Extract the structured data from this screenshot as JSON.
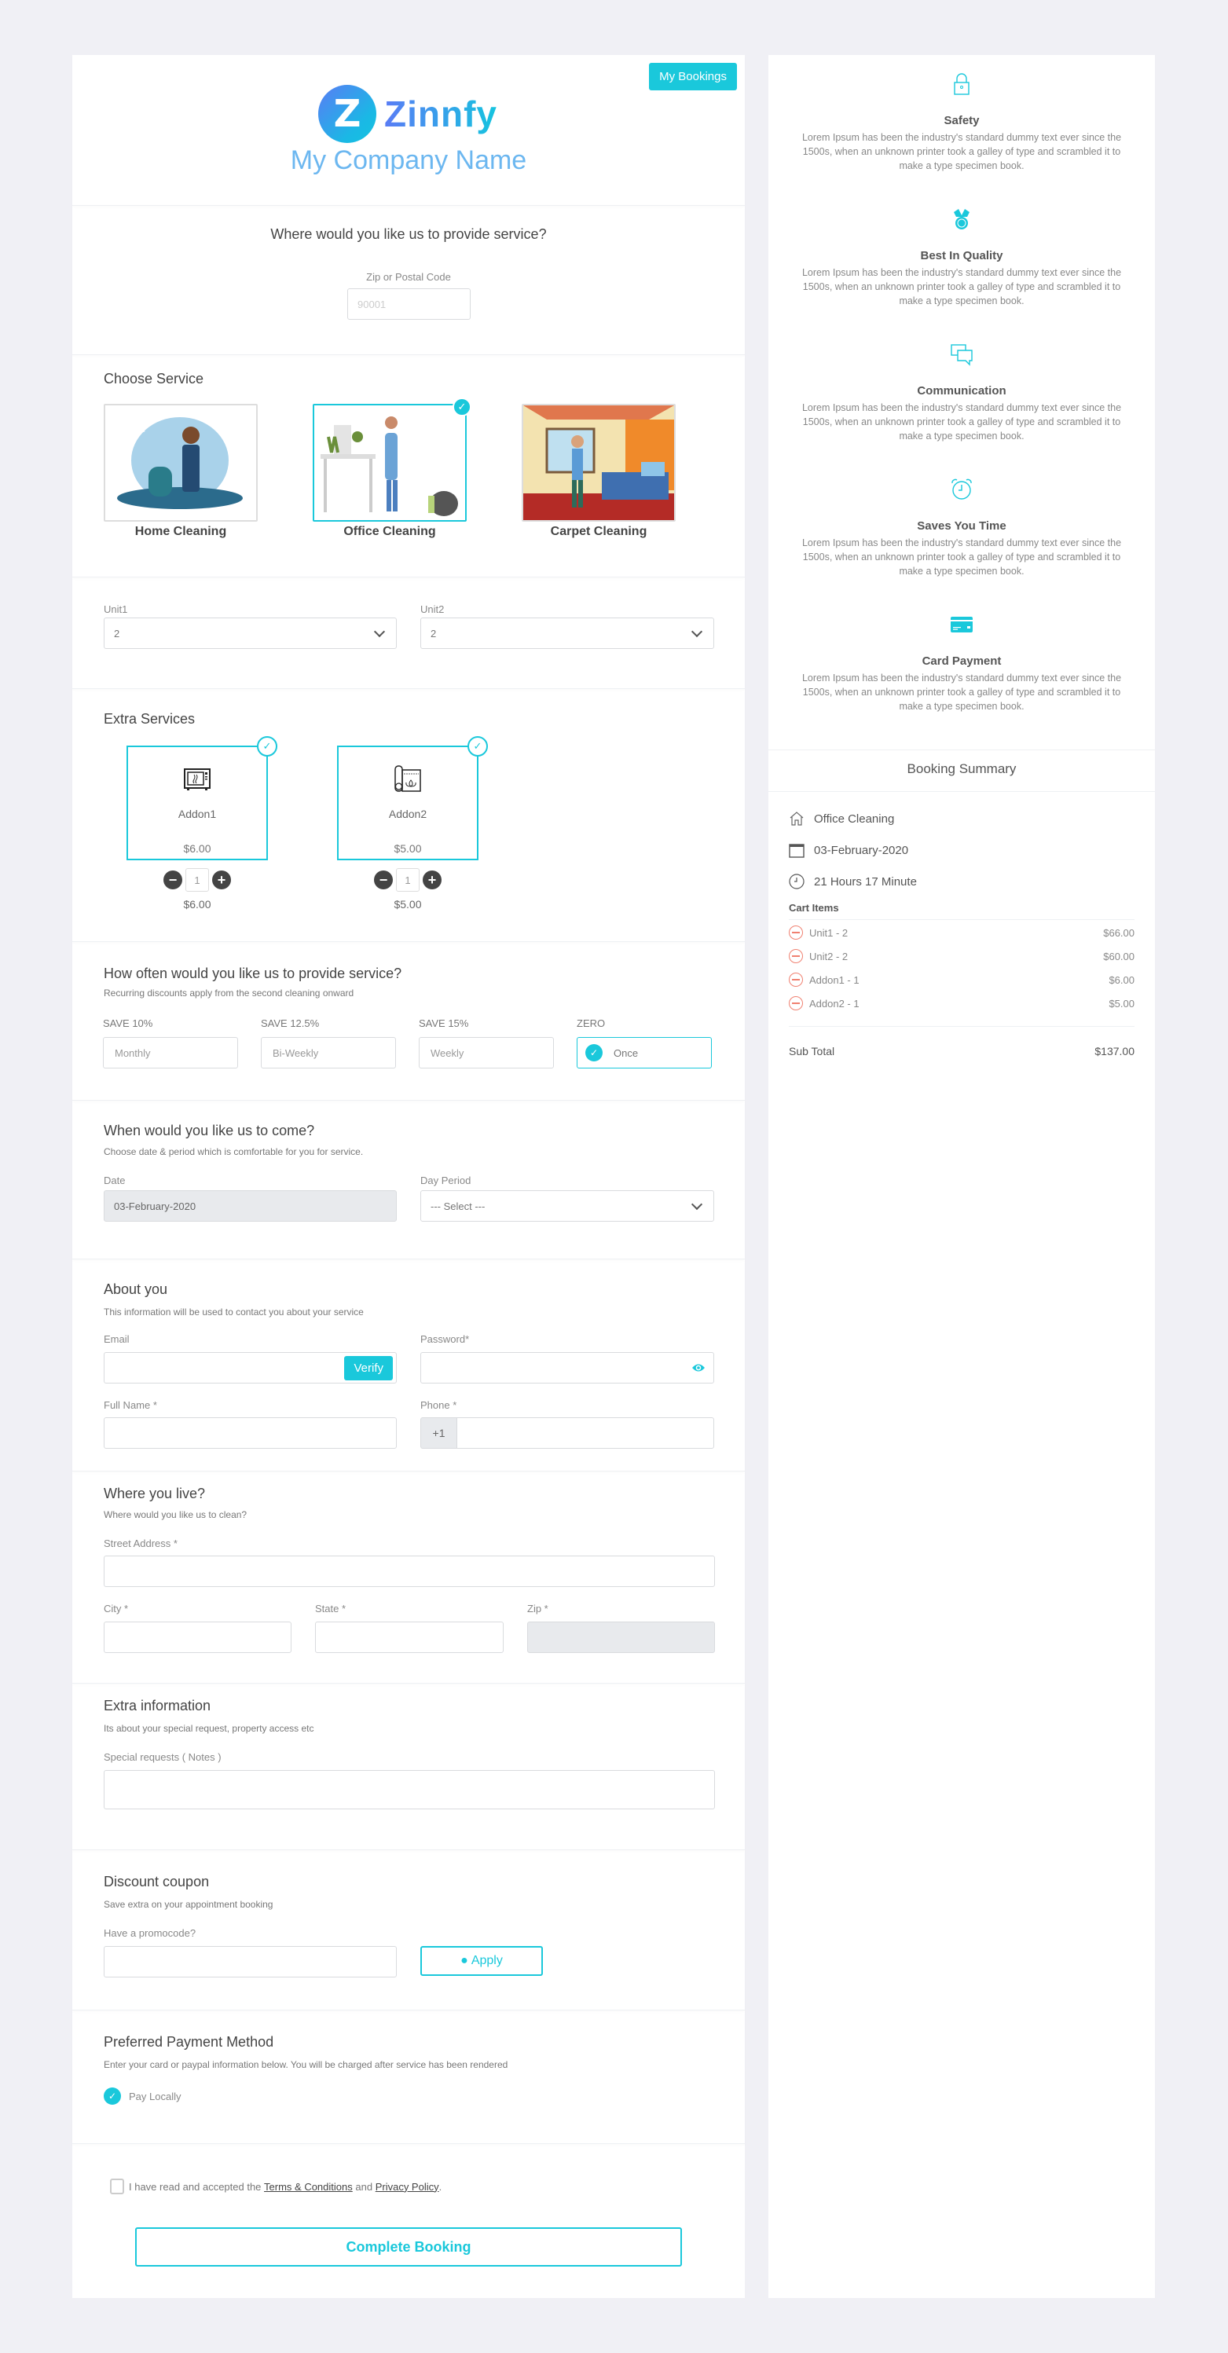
{
  "header": {
    "my_bookings": "My Bookings",
    "logo_letter": "Z",
    "logo_text": "Zinnfy",
    "company_name": "My Company Name"
  },
  "location": {
    "title": "Where would you like us to provide service?",
    "zip_label": "Zip or Postal Code",
    "zip_placeholder": "90001"
  },
  "choose_service": {
    "title": "Choose Service",
    "items": [
      {
        "name": "Home Cleaning",
        "selected": false
      },
      {
        "name": "Office Cleaning",
        "selected": true
      },
      {
        "name": "Carpet Cleaning",
        "selected": false
      }
    ]
  },
  "units": {
    "unit1_label": "Unit1",
    "unit1_value": "2",
    "unit2_label": "Unit2",
    "unit2_value": "2"
  },
  "extra_services": {
    "title": "Extra Services",
    "items": [
      {
        "name": "Addon1",
        "price": "$6.00",
        "qty": "1",
        "total": "$6.00",
        "icon": "microwave-icon",
        "selected": true
      },
      {
        "name": "Addon2",
        "price": "$5.00",
        "qty": "1",
        "total": "$5.00",
        "icon": "yoga-mat-icon",
        "selected": true
      }
    ]
  },
  "frequency": {
    "title": "How often would you like us to provide service?",
    "subtitle": "Recurring discounts apply from the second cleaning onward",
    "options": [
      {
        "save": "SAVE 10%",
        "label": "Monthly",
        "selected": false
      },
      {
        "save": "SAVE 12.5%",
        "label": "Bi-Weekly",
        "selected": false
      },
      {
        "save": "SAVE 15%",
        "label": "Weekly",
        "selected": false
      },
      {
        "save": "ZERO",
        "label": "Once",
        "selected": true
      }
    ]
  },
  "schedule": {
    "title": "When would you like us to come?",
    "subtitle": "Choose date & period which is comfortable for you for service.",
    "date_label": "Date",
    "date_value": "03-February-2020",
    "period_label": "Day Period",
    "period_value": "--- Select ---"
  },
  "about": {
    "title": "About you",
    "subtitle": "This information will be used to contact you about your service",
    "email_label": "Email",
    "verify": "Verify",
    "password_label": "Password*",
    "fullname_label": "Full Name *",
    "phone_label": "Phone *",
    "phone_prefix": "+1"
  },
  "address": {
    "title": "Where you live?",
    "subtitle": "Where would you like us to clean?",
    "street_label": "Street Address *",
    "city_label": "City *",
    "state_label": "State *",
    "zip_label": "Zip *"
  },
  "extra_info": {
    "title": "Extra information",
    "subtitle": "Its about your special request, property access etc",
    "notes_label": "Special requests ( Notes )"
  },
  "coupon": {
    "title": "Discount coupon",
    "subtitle": "Save extra on your appointment booking",
    "promo_label": "Have a promocode?",
    "apply": "Apply"
  },
  "payment": {
    "title": "Preferred Payment Method",
    "subtitle": "Enter your card or paypal information below. You will be charged after service has been rendered",
    "option": "Pay Locally",
    "selected": true
  },
  "footer": {
    "terms_prefix": "I have read and accepted the ",
    "terms_link": "Terms & Conditions",
    "and": " and ",
    "privacy_link": "Privacy Policy",
    "period": ".",
    "complete": "Complete Booking"
  },
  "features": [
    {
      "title": "Safety",
      "icon": "lock-icon",
      "desc": "Lorem Ipsum has been the industry's standard dummy text ever since the 1500s, when an unknown printer took a galley of type and scrambled it to make a type specimen book."
    },
    {
      "title": "Best In Quality",
      "icon": "medal-icon",
      "desc": "Lorem Ipsum has been the industry's standard dummy text ever since the 1500s, when an unknown printer took a galley of type and scrambled it to make a type specimen book."
    },
    {
      "title": "Communication",
      "icon": "chat-icon",
      "desc": "Lorem Ipsum has been the industry's standard dummy text ever since the 1500s, when an unknown printer took a galley of type and scrambled it to make a type specimen book."
    },
    {
      "title": "Saves You Time",
      "icon": "alarm-clock-icon",
      "desc": "Lorem Ipsum has been the industry's standard dummy text ever since the 1500s, when an unknown printer took a galley of type and scrambled it to make a type specimen book."
    },
    {
      "title": "Card Payment",
      "icon": "credit-card-icon",
      "desc": "Lorem Ipsum has been the industry's standard dummy text ever since the 1500s, when an unknown printer took a galley of type and scrambled it to make a type specimen book."
    }
  ],
  "summary": {
    "title": "Booking Summary",
    "service": "Office Cleaning",
    "date": "03-February-2020",
    "duration": "21 Hours 17 Minute",
    "cart_title": "Cart Items",
    "cart": [
      {
        "label": "Unit1 - 2",
        "price": "$66.00"
      },
      {
        "label": "Unit2 - 2",
        "price": "$60.00"
      },
      {
        "label": "Addon1 - 1",
        "price": "$6.00"
      },
      {
        "label": "Addon2 - 1",
        "price": "$5.00"
      }
    ],
    "subtotal_label": "Sub Total",
    "subtotal": "$137.00"
  },
  "colors": {
    "accent": "#1ac8db",
    "background": "#f0f0f5",
    "remove": "#f08070"
  }
}
